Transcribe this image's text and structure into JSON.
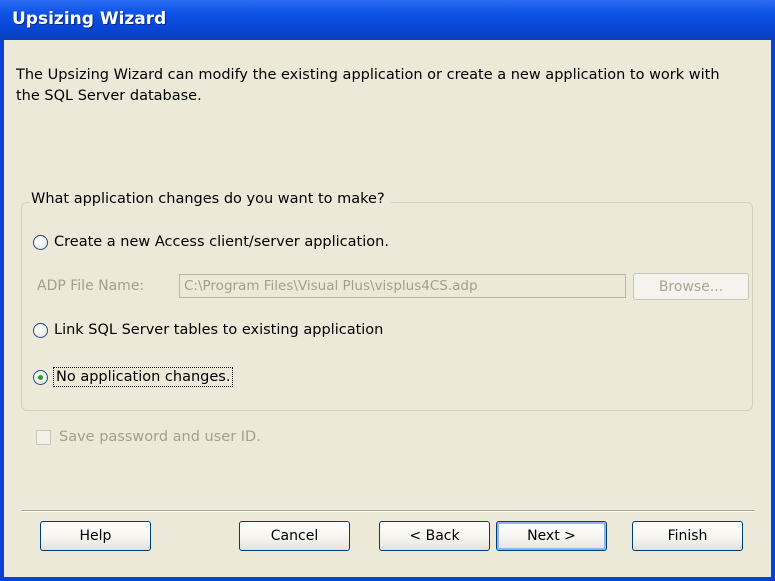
{
  "window": {
    "title": "Upsizing Wizard"
  },
  "intro_text": "The Upsizing Wizard can modify the existing application or create a new application to work with the SQL Server database.",
  "group": {
    "legend": "What application changes do you want to make?",
    "options": [
      {
        "label": "Create a new Access client/server application.",
        "checked": false
      },
      {
        "label": "Link SQL Server tables to existing application",
        "checked": false
      },
      {
        "label": "No application changes.",
        "checked": true
      }
    ],
    "adp_label": "ADP File Name:",
    "adp_value": "C:\\Program Files\\Visual Plus\\visplus4CS.adp",
    "browse_label": "Browse..."
  },
  "save_password": {
    "label": "Save password and user ID.",
    "checked": false,
    "enabled": false
  },
  "buttons": {
    "help": "Help",
    "cancel": "Cancel",
    "back": "< Back",
    "next": "Next >",
    "finish": "Finish"
  }
}
